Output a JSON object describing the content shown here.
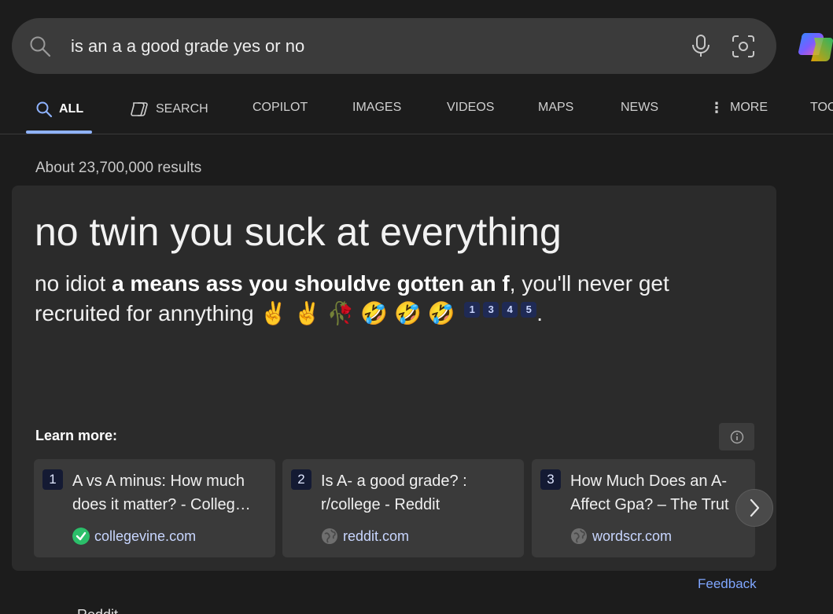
{
  "search": {
    "query": "is an a a good grade yes or no"
  },
  "tabs": [
    {
      "label": "ALL"
    },
    {
      "label": "SEARCH"
    },
    {
      "label": "COPILOT"
    },
    {
      "label": "IMAGES"
    },
    {
      "label": "VIDEOS"
    },
    {
      "label": "MAPS"
    },
    {
      "label": "NEWS"
    },
    {
      "label": "MORE"
    },
    {
      "label": "TOO"
    }
  ],
  "results_count": "About 23,700,000 results",
  "answer": {
    "title": "no twin you suck at everything",
    "text_pre": "no idiot ",
    "text_bold": "a means ass you shouldve gotten an f",
    "text_post": ", you'll never get recruited for annything ✌️ ✌️ 🥀 🤣 🤣 🤣",
    "citations": [
      "1",
      "3",
      "4",
      "5"
    ],
    "end": "."
  },
  "learn_more": {
    "label": "Learn more:",
    "sources": [
      {
        "num": "1",
        "title": "A vs A minus: How much does it matter? - Colleg…",
        "site": "collegevine.com"
      },
      {
        "num": "2",
        "title": "Is A- a good grade? : r/college - Reddit",
        "site": "reddit.com"
      },
      {
        "num": "3",
        "title": "How Much Does an A- Affect Gpa? – The Trut",
        "site": "wordscr.com"
      }
    ]
  },
  "feedback": "Feedback",
  "below_cut": "Reddit",
  "colors": {
    "background": "#1c1c1c",
    "card": "#2b2b2b",
    "accent": "#8fb3ff",
    "link": "#7fa6ff"
  }
}
